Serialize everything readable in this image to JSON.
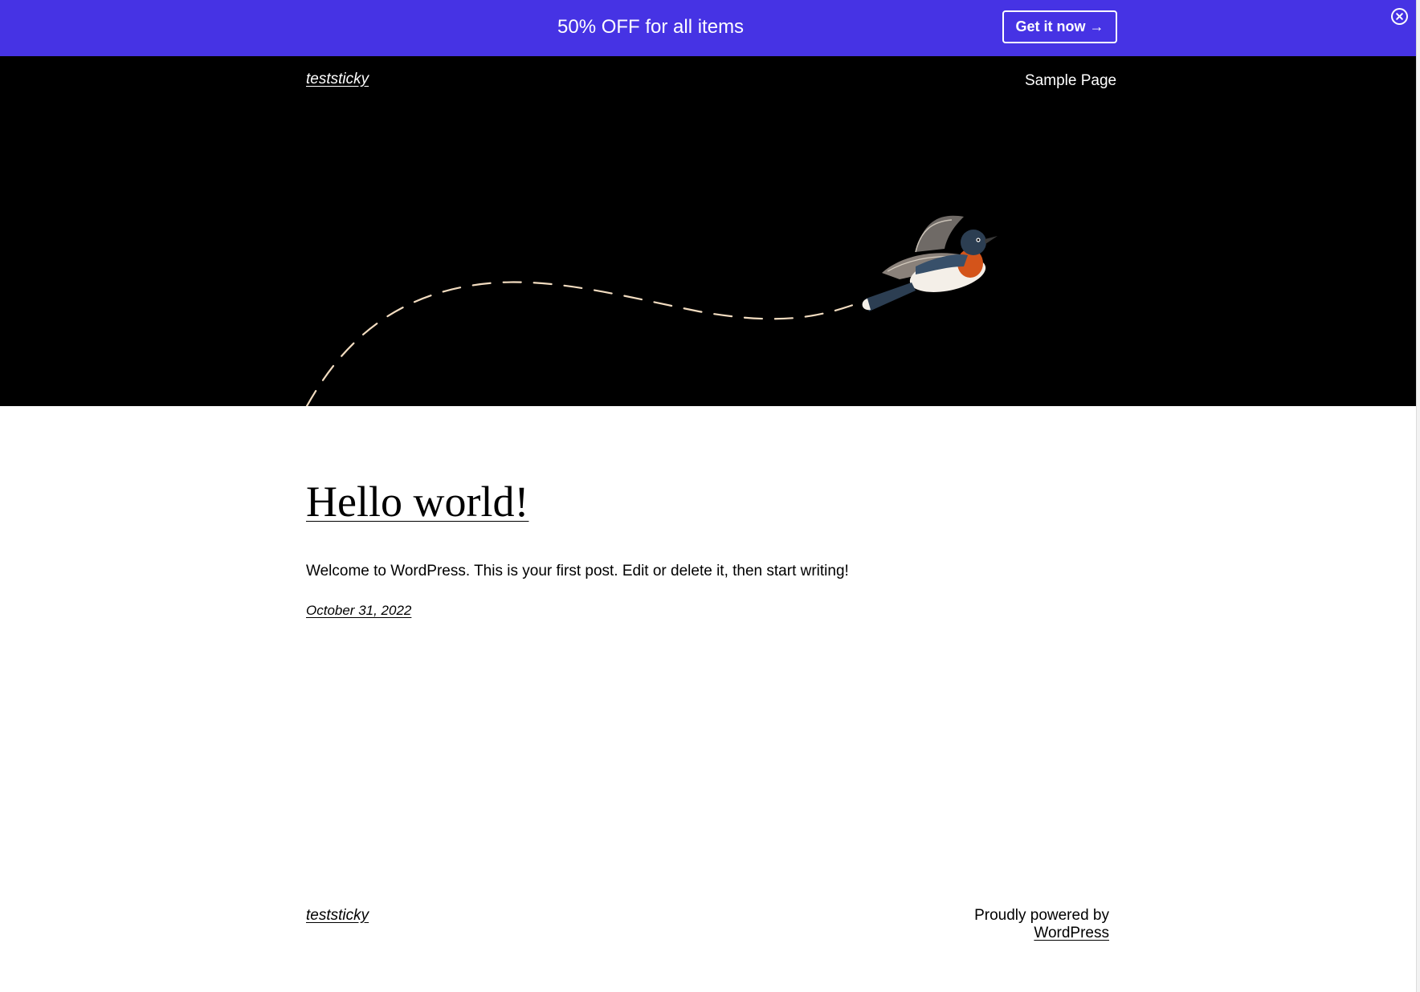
{
  "promo_bar": {
    "message": "50% OFF for all items",
    "cta_label": "Get it now →",
    "background_color": "#4633e4",
    "close_icon": "close-icon"
  },
  "header": {
    "site_title": "teststicky",
    "nav": [
      {
        "label": "Sample Page"
      }
    ],
    "hero_image": "bird-illustration"
  },
  "post": {
    "title": "Hello world!",
    "excerpt": "Welcome to WordPress. This is your first post. Edit or delete it, then start writing!",
    "date": "October 31, 2022"
  },
  "footer": {
    "site_title": "teststicky",
    "credit_prefix": "Proudly powered by ",
    "credit_link": "WordPress"
  }
}
